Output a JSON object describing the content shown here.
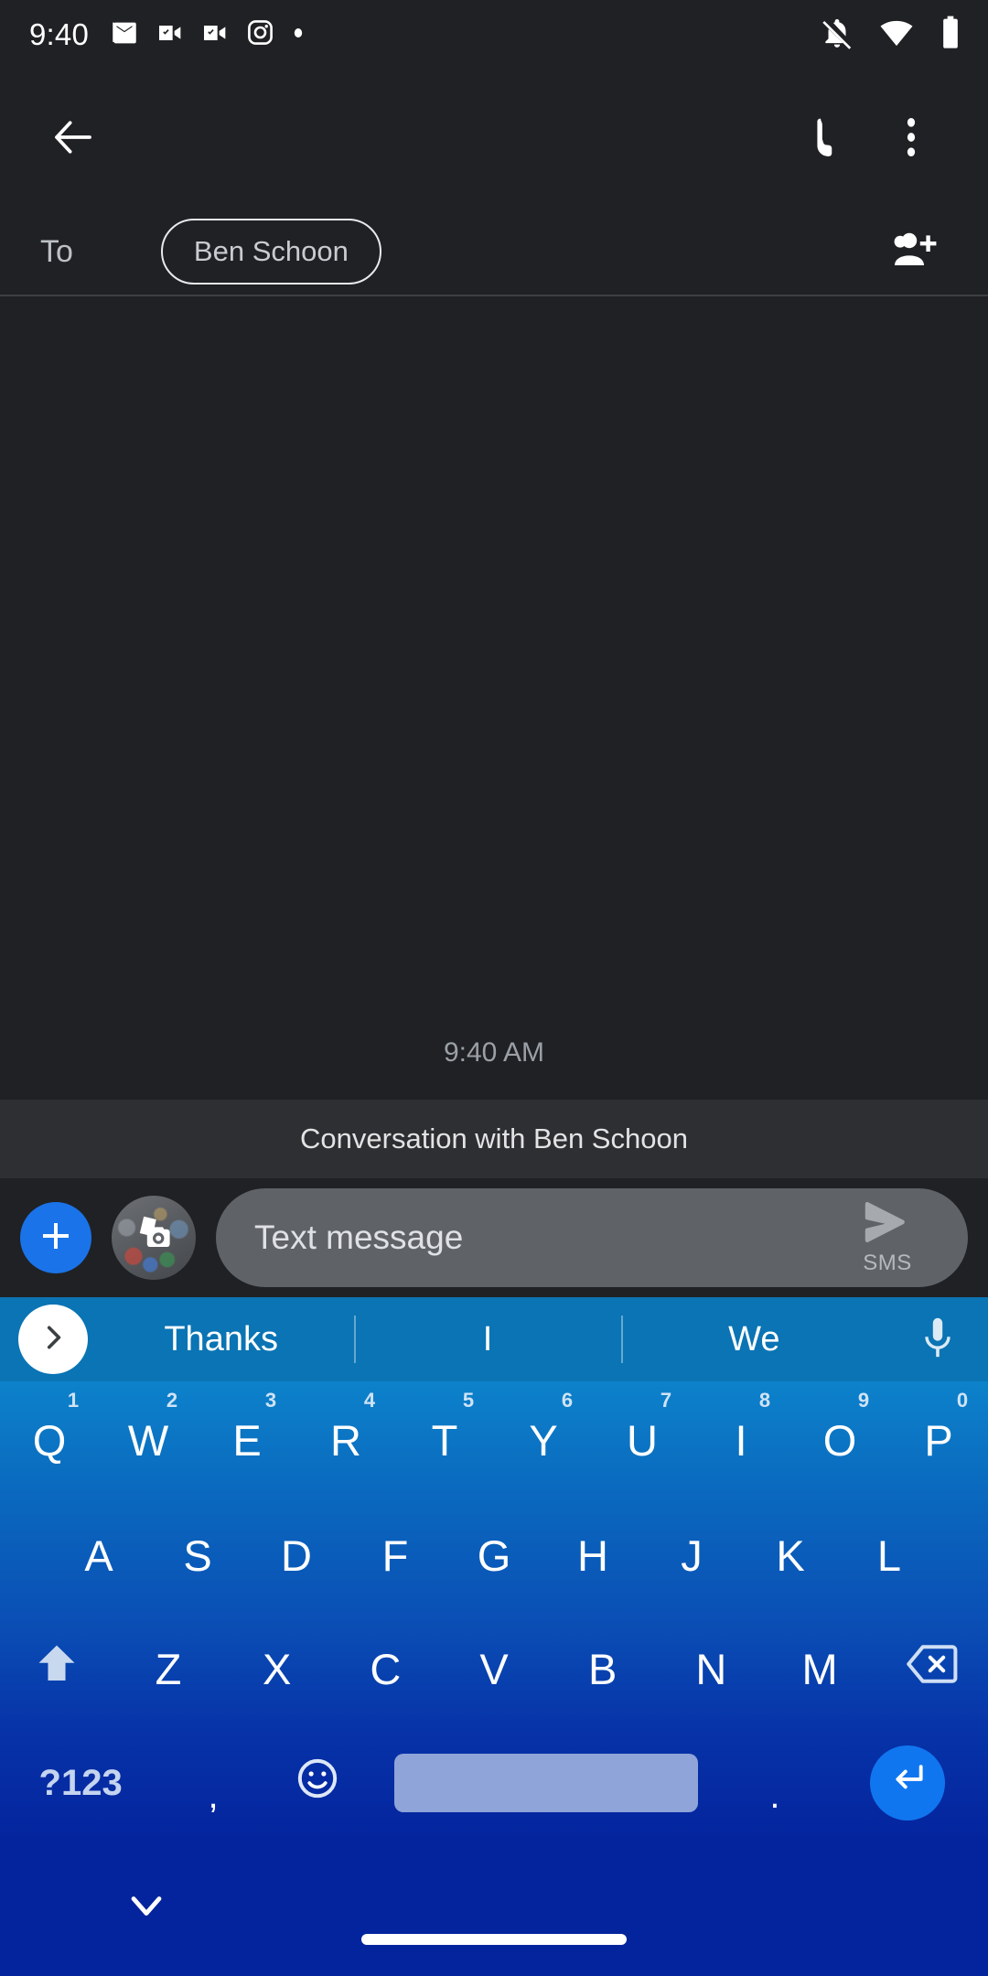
{
  "status_bar": {
    "time": "9:40",
    "left_icons": [
      "gmail-icon",
      "video-message-icon",
      "video-message-icon",
      "instagram-icon",
      "dot-icon"
    ],
    "right_icons": [
      "notifications-off-icon",
      "wifi-icon",
      "battery-full-icon"
    ]
  },
  "app_bar": {
    "back": "back-arrow-icon",
    "call": "phone-icon",
    "overflow": "more-vert-icon"
  },
  "recipient": {
    "to_label": "To",
    "chip_name": "Ben Schoon",
    "add_contact": "add-people-icon"
  },
  "conversation": {
    "timestamp": "9:40 AM",
    "banner": "Conversation with Ben Schoon"
  },
  "compose": {
    "plus_label": "+",
    "attach_camera": "camera-gallery-icon",
    "placeholder": "Text message",
    "send_icon": "send-icon",
    "send_type": "SMS"
  },
  "keyboard": {
    "suggestions": [
      "Thanks",
      "I",
      "We"
    ],
    "expand_icon": "chevron-right-icon",
    "mic_icon": "microphone-icon",
    "row1": [
      {
        "letter": "Q",
        "num": "1"
      },
      {
        "letter": "W",
        "num": "2"
      },
      {
        "letter": "E",
        "num": "3"
      },
      {
        "letter": "R",
        "num": "4"
      },
      {
        "letter": "T",
        "num": "5"
      },
      {
        "letter": "Y",
        "num": "6"
      },
      {
        "letter": "U",
        "num": "7"
      },
      {
        "letter": "I",
        "num": "8"
      },
      {
        "letter": "O",
        "num": "9"
      },
      {
        "letter": "P",
        "num": "0"
      }
    ],
    "row2": [
      "A",
      "S",
      "D",
      "F",
      "G",
      "H",
      "J",
      "K",
      "L"
    ],
    "row3": [
      "Z",
      "X",
      "C",
      "V",
      "B",
      "N",
      "M"
    ],
    "shift_icon": "shift-arrow-icon",
    "backspace_icon": "backspace-icon",
    "symbols_key": "?123",
    "comma_key": ",",
    "emoji_icon": "emoji-smiley-icon",
    "space_key": "",
    "period_key": ".",
    "enter_icon": "enter-return-icon"
  },
  "nav_bar": {
    "hide_keyboard": "chevron-down-icon",
    "gesture_pill": "home-gesture-pill"
  },
  "colors": {
    "background": "#202124",
    "banner_bg": "#2d2f33",
    "field_bg": "#5f6368",
    "accent_blue": "#1a73e8",
    "suggestion_bar": "#0a74b4",
    "keyboard_top": "#0d82cb",
    "keyboard_bottom": "#04249e",
    "spacebar": "#8fa4d8"
  }
}
